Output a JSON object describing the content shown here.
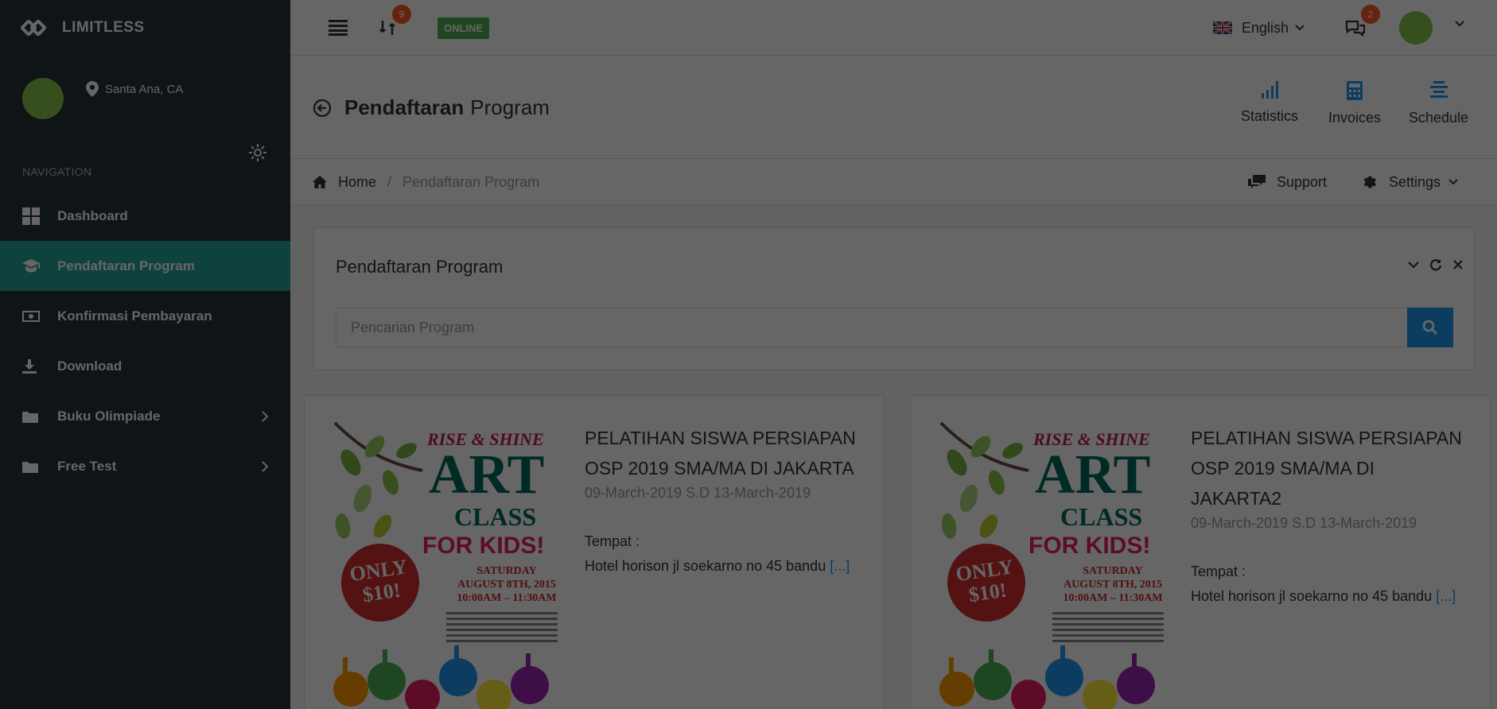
{
  "brand": {
    "name": "LIMITLESS"
  },
  "user": {
    "location": "Santa Ana, CA"
  },
  "nav": {
    "header": "NAVIGATION",
    "items": [
      {
        "label": "Dashboard",
        "icon": "grid-icon"
      },
      {
        "label": "Pendaftaran Program",
        "icon": "graduation-cap-icon",
        "active": true
      },
      {
        "label": "Konfirmasi Pembayaran",
        "icon": "money-icon"
      },
      {
        "label": "Download",
        "icon": "download-icon"
      },
      {
        "label": "Buku Olimpiade",
        "icon": "folder-icon",
        "has_children": true
      },
      {
        "label": "Free Test",
        "icon": "folder-icon",
        "has_children": true
      }
    ]
  },
  "topbar": {
    "updates_badge": "9",
    "status": "ONLINE",
    "language": "English",
    "messages_badge": "2"
  },
  "page": {
    "title_bold": "Pendaftaran",
    "title_rest": "Program",
    "header_buttons": [
      {
        "label": "Statistics",
        "icon": "bar-chart-icon"
      },
      {
        "label": "Invoices",
        "icon": "calculator-icon"
      },
      {
        "label": "Schedule",
        "icon": "list-icon"
      }
    ]
  },
  "breadcrumb": {
    "home": "Home",
    "separator": "/",
    "current": "Pendaftaran Program",
    "support": "Support",
    "settings": "Settings"
  },
  "panel": {
    "title": "Pendaftaran Program",
    "search_placeholder": "Pencarian Program"
  },
  "programs": [
    {
      "title": "PELATIHAN SISWA PERSIAPAN OSP 2019 SMA/MA DI JAKARTA",
      "date": "09-March-2019 S.D 13-March-2019",
      "place_label": "Tempat :",
      "place": "Hotel horison jl soekarno no 45 bandu",
      "more": "[...]"
    },
    {
      "title": "PELATIHAN SISWA PERSIAPAN OSP 2019 SMA/MA DI JAKARTA2",
      "date": "09-March-2019 S.D 13-March-2019",
      "place_label": "Tempat :",
      "place": "Hotel horison jl soekarno no 45 bandu",
      "more": "[...]"
    }
  ],
  "poster": {
    "top": "RISE & SHINE",
    "art": "ART",
    "class": "CLASS",
    "kids": "FOR KIDS!",
    "day": "SATURDAY",
    "date": "AUGUST 8TH, 2015",
    "time": "10:00AM – 11:30AM",
    "price_1": "ONLY",
    "price_2": "$10!"
  },
  "colors": {
    "sidebar": "#263238",
    "active": "#26a69a",
    "primary": "#2196f3",
    "badge": "#ff5722",
    "online": "#4caf50"
  }
}
